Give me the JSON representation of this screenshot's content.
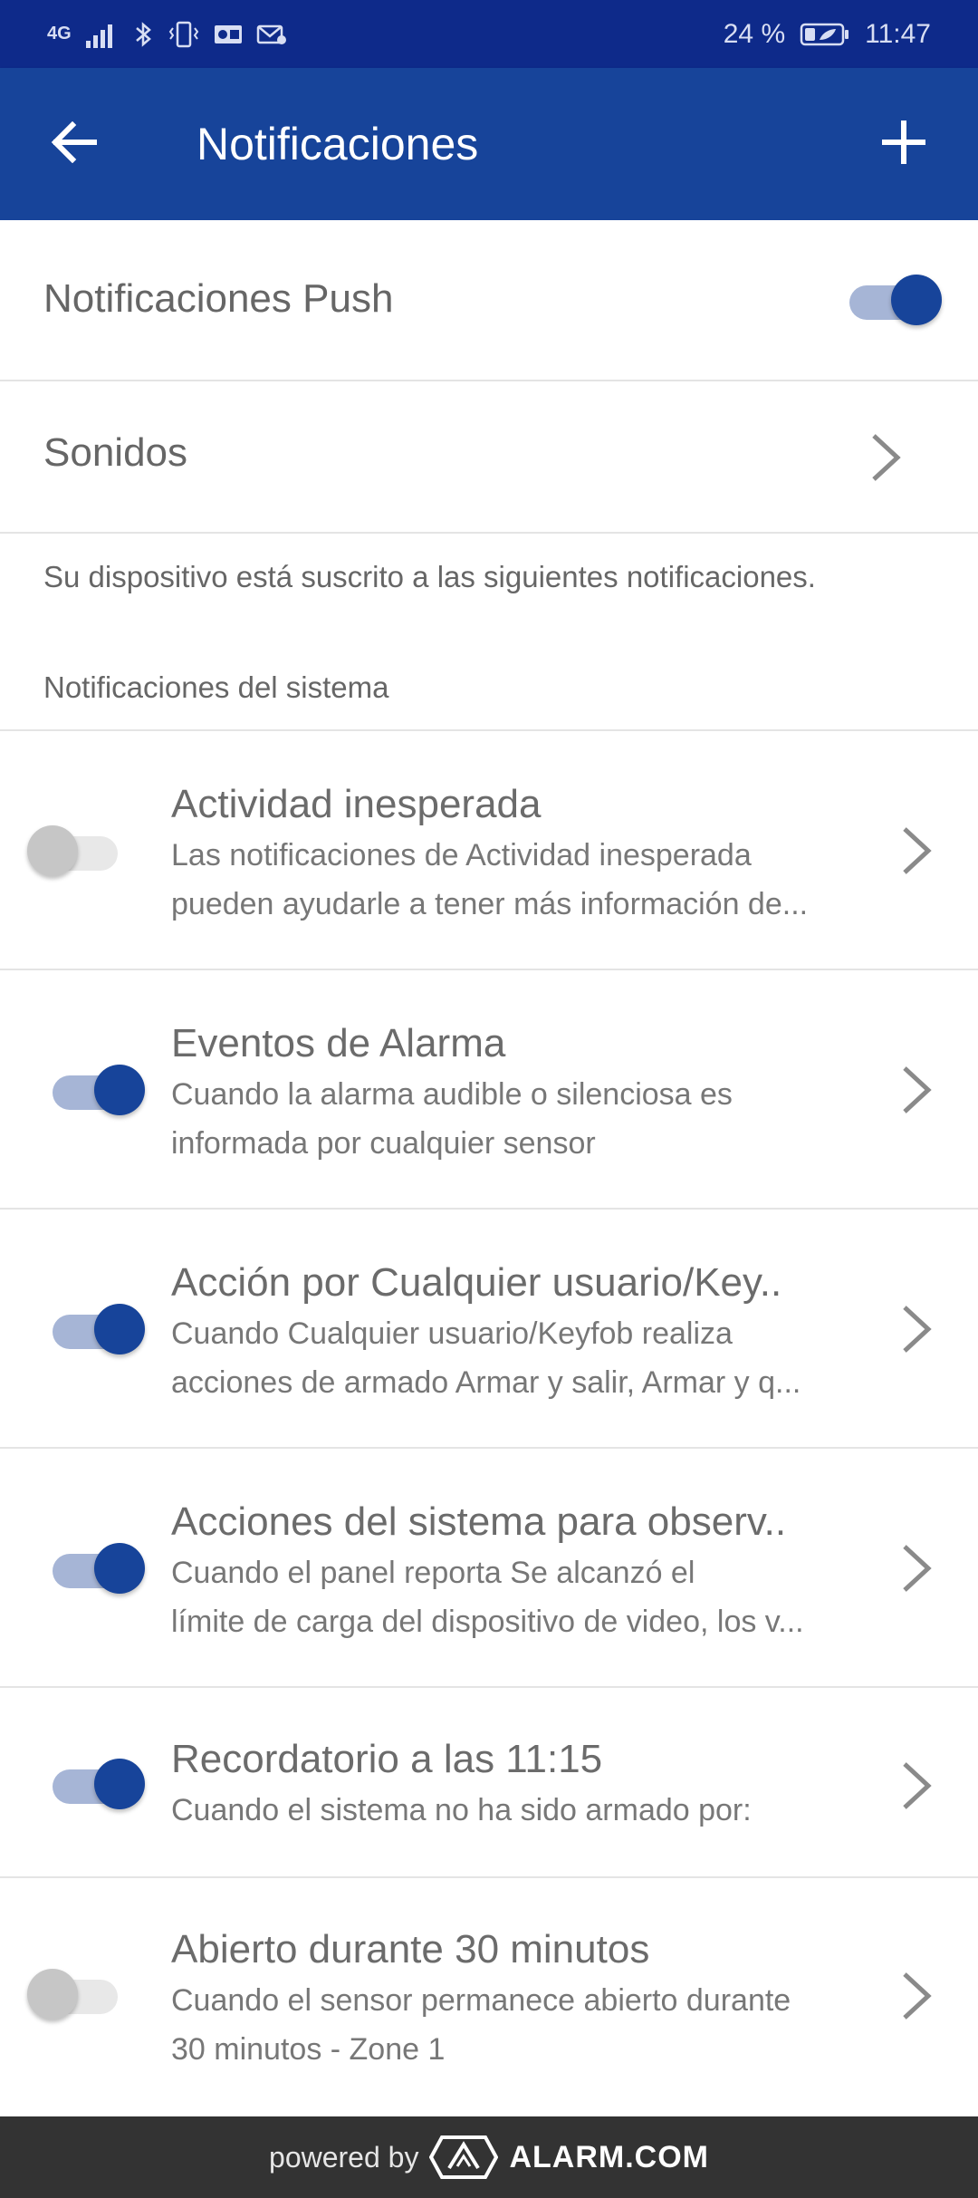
{
  "status_bar": {
    "network": "4G",
    "battery_percent": "24 %",
    "time": "11:47",
    "icons": [
      "signal-icon",
      "bluetooth-icon",
      "vibrate-icon",
      "outlook-icon",
      "mail-icon",
      "battery-icon"
    ]
  },
  "app_bar": {
    "title": "Notificaciones",
    "back_icon": "arrow-left-icon",
    "add_icon": "plus-icon"
  },
  "push_row": {
    "label": "Notificaciones Push",
    "enabled": true
  },
  "sounds_row": {
    "label": "Sonidos"
  },
  "info_text": "Su dispositivo está suscrito a las siguientes notificaciones.",
  "section_header": "Notificaciones del sistema",
  "notifications": [
    {
      "title": "Actividad inesperada",
      "desc_line1": "Las notificaciones de Actividad inesperada",
      "desc_line2": "pueden ayudarle a tener más información de...",
      "enabled": false
    },
    {
      "title": "Eventos de Alarma",
      "desc_line1": "Cuando la alarma audible o silenciosa es",
      "desc_line2": "informada por cualquier sensor",
      "enabled": true
    },
    {
      "title": "Acción por Cualquier usuario/Key..",
      "desc_line1": "Cuando Cualquier usuario/Keyfob realiza",
      "desc_line2": "acciones de armado Armar y salir, Armar y q...",
      "enabled": true
    },
    {
      "title": "Acciones del sistema para observ..",
      "desc_line1": "Cuando el panel reporta Se alcanzó el",
      "desc_line2": "límite de carga del dispositivo de video, los v...",
      "enabled": true
    },
    {
      "title": "Recordatorio a las 11:15",
      "desc_line1": "Cuando el sistema no ha sido armado por:",
      "desc_line2": "",
      "enabled": true
    },
    {
      "title": "Abierto durante 30 minutos",
      "desc_line1": "Cuando el sensor permanece abierto durante",
      "desc_line2": "30 minutos - Zone 1",
      "enabled": false
    }
  ],
  "footer": {
    "powered_by": "powered by",
    "brand": "ALARM.COM",
    "logo_icon": "alarm-com-logo-icon"
  },
  "colors": {
    "status_bar": "#0e2a8a",
    "app_bar": "#17449a",
    "toggle_on": "#17449a",
    "toggle_off": "#c6c6c6",
    "footer": "#333333"
  }
}
